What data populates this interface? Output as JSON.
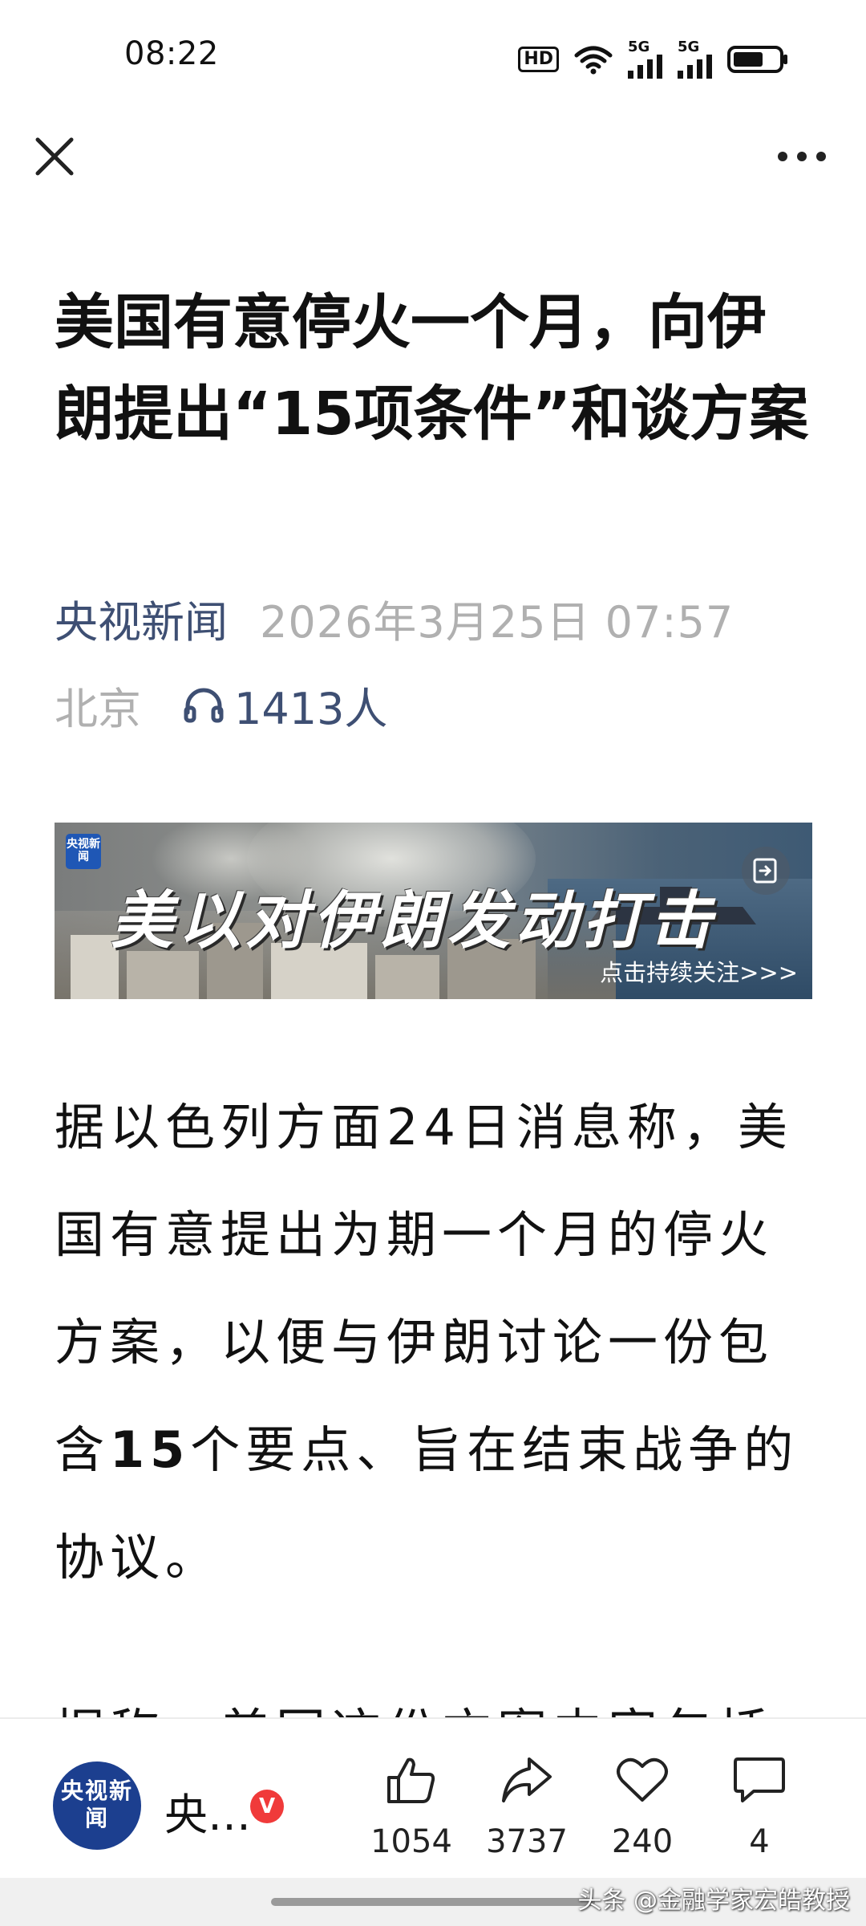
{
  "status_bar": {
    "time": "08:22",
    "hd_label": "HD",
    "network_1": "5G",
    "network_2": "5G"
  },
  "nav": {
    "close_icon": "close-icon",
    "more_icon": "more-icon"
  },
  "article": {
    "title": "美国有意停火一个月，向伊朗提出“15项条件”和谈方案",
    "source": "央视新闻",
    "publish_time": "2026年3月25日 07:57",
    "location": "北京",
    "listen_count": "1413人"
  },
  "banner": {
    "logo_text": "央视新闻",
    "headline": "美以对伊朗发动打击",
    "follow_text": "点击持续关注>>>"
  },
  "body": {
    "p1_part1": "据以色列方面24日消息称，美国有意提出为期一个月的停火方案，以便与伊朗讨论一份包含",
    "p1_bold": "15",
    "p1_part2": "个要点、旨在结束战争的协议。",
    "p2_partial": "据称，美国这份方案内容包括："
  },
  "bottom_bar": {
    "author_avatar_text": "央视新闻",
    "author_name": "央…",
    "verified": "V",
    "likes": "1054",
    "shares": "3737",
    "favorites": "240",
    "comments": "4"
  },
  "watermark": "头条 @金融学家宏皓教授",
  "colors": {
    "source_blue": "#3e4f73",
    "meta_gray": "#b0b0b0",
    "verified_red": "#f03a3a",
    "avatar_blue": "#1c3f8f"
  }
}
